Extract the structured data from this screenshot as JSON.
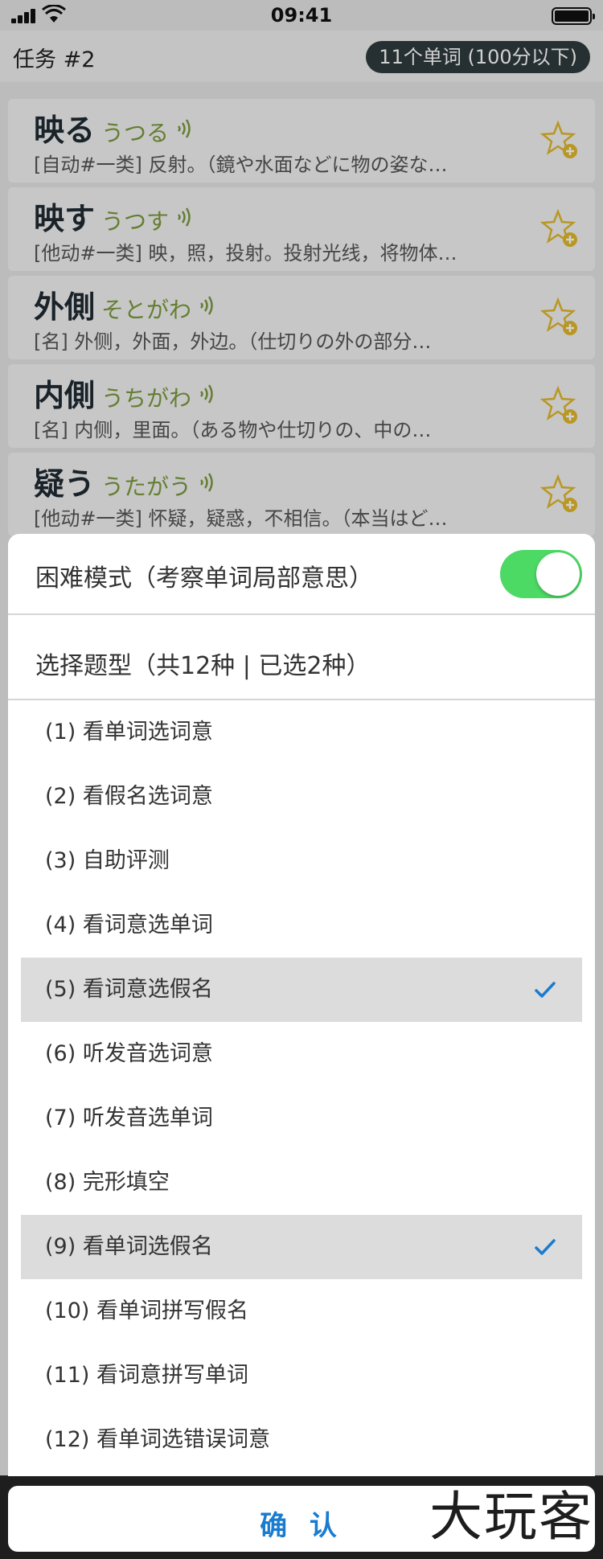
{
  "status_bar": {
    "time": "09:41",
    "icons": [
      "signal-icon",
      "wifi-icon",
      "battery-icon"
    ]
  },
  "nav": {
    "title": "任务 #2",
    "badge": "11个单词 (100分以下)"
  },
  "words": [
    {
      "kanji": "映る",
      "kana": "うつる",
      "definition": "[自动#一类] 反射。（鏡や水面などに物の姿な…"
    },
    {
      "kanji": "映す",
      "kana": "うつす",
      "definition": "[他动#一类] 映，照，投射。投射光线，将物体…"
    },
    {
      "kanji": "外側",
      "kana": "そとがわ",
      "definition": "[名] 外侧，外面，外边。（仕切りの外の部分…"
    },
    {
      "kanji": "内側",
      "kana": "うちがわ",
      "definition": "[名] 内侧，里面。（ある物や仕切りの、中の…"
    },
    {
      "kanji": "疑う",
      "kana": "うたがう",
      "definition": "[他动#一类] 怀疑，疑惑，不相信。（本当はど…"
    }
  ],
  "sheet": {
    "hard_mode_label": "困难模式（考察单词局部意思）",
    "hard_mode_on": true,
    "type_header": "选择题型（共12种 | 已选2种）",
    "options": [
      {
        "label": "(1) 看单词选词意",
        "selected": false
      },
      {
        "label": "(2) 看假名选词意",
        "selected": false
      },
      {
        "label": "(3) 自助评测",
        "selected": false
      },
      {
        "label": "(4) 看词意选单词",
        "selected": false
      },
      {
        "label": "(5) 看词意选假名",
        "selected": true
      },
      {
        "label": "(6) 听发音选词意",
        "selected": false
      },
      {
        "label": "(7) 听发音选单词",
        "selected": false
      },
      {
        "label": "(8) 完形填空",
        "selected": false
      },
      {
        "label": "(9) 看单词选假名",
        "selected": true
      },
      {
        "label": "(10) 看单词拼写假名",
        "selected": false
      },
      {
        "label": "(11) 看词意拼写单词",
        "selected": false
      },
      {
        "label": "(12) 看单词选错误词意",
        "selected": false
      }
    ]
  },
  "confirm_label": "确 认",
  "watermark": "大玩客",
  "colors": {
    "toggle_on": "#4cd964",
    "check": "#1a7ccf",
    "kana": "#7b9a3e",
    "star": "#e2b92b",
    "confirm_text": "#1a7ccf"
  }
}
